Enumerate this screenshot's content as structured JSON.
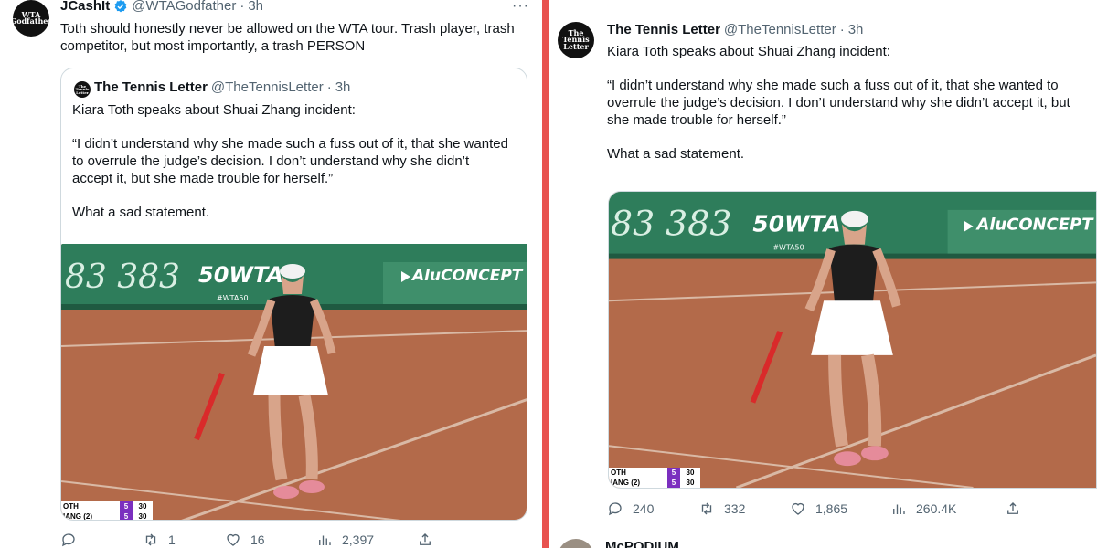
{
  "left_tweet": {
    "author_name": "JCashIt",
    "author_handle": "@WTAGodfather",
    "time": "3h",
    "avatar_text": "WTA Godfather",
    "more": "···",
    "text": "Toth should honestly never be allowed on the WTA tour. Trash player, trash competitor, but most importantly, a trash PERSON",
    "quoted": {
      "author_name": "The Tennis Letter",
      "author_handle": "@TheTennisLetter",
      "time": "3h",
      "avatar_text": "The Tennis Letter",
      "line1": "Kiara Toth speaks about Shuai Zhang incident:",
      "quote": "“I didn’t understand why she made such a fuss out of it, that she wanted to overrule the judge’s decision. I don’t understand why she didn’t accept it, but she made trouble for herself.”",
      "closing": "What a sad statement."
    },
    "metrics": {
      "replies": "",
      "retweets": "1",
      "likes": "16",
      "views": "2,397"
    }
  },
  "right_tweet": {
    "author_name": "The Tennis Letter",
    "author_handle": "@TheTennisLetter",
    "time": "3h",
    "avatar_text": "The Tennis Letter",
    "line1": "Kiara Toth speaks about Shuai Zhang incident:",
    "quote": "“I didn’t understand why she made such a fuss out of it, that she wanted to overrule the judge’s decision. I don’t understand why she didn’t accept it, but she made trouble for herself.”",
    "closing": "What a sad statement.",
    "metrics": {
      "replies": "240",
      "retweets": "332",
      "likes": "1,865",
      "views": "260.4K"
    }
  },
  "next_reply_name": "McPODIUM",
  "media": {
    "board_digits": "83 383",
    "board_logo": "50WTA",
    "board_tag": "#WTA50",
    "sponsor": "AluCONCEPT",
    "score": [
      {
        "player": "OTH",
        "set": "5",
        "points": "30"
      },
      {
        "player": "IANG (2)",
        "set": "5",
        "points": "30"
      }
    ]
  },
  "colors": {
    "divider": "#e8524f",
    "clay": "#b36a4a",
    "board": "#2e7d5b",
    "verified": "#1d9bf0",
    "score_set": "#7b2fbf"
  }
}
